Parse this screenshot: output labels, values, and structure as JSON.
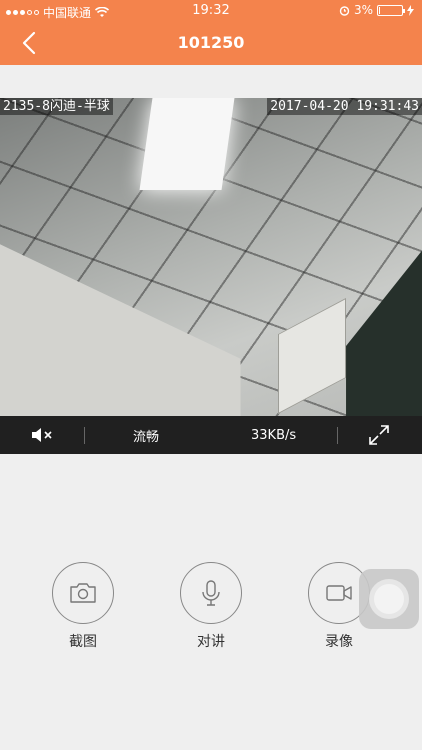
{
  "status_bar": {
    "carrier": "中国联通",
    "time": "19:32",
    "battery_percent": "3%",
    "battery_level": 0.03
  },
  "nav": {
    "title": "101250"
  },
  "video": {
    "osd_channel": "2135-8闪迪-半球",
    "osd_datetime": "2017-04-20 19:31:43"
  },
  "controls": {
    "quality_label": "流畅",
    "bitrate": "33KB/s"
  },
  "actions": {
    "screenshot_label": "截图",
    "intercom_label": "对讲",
    "record_label": "录像"
  },
  "colors": {
    "accent": "#f4834c",
    "control_bar": "#202020"
  }
}
